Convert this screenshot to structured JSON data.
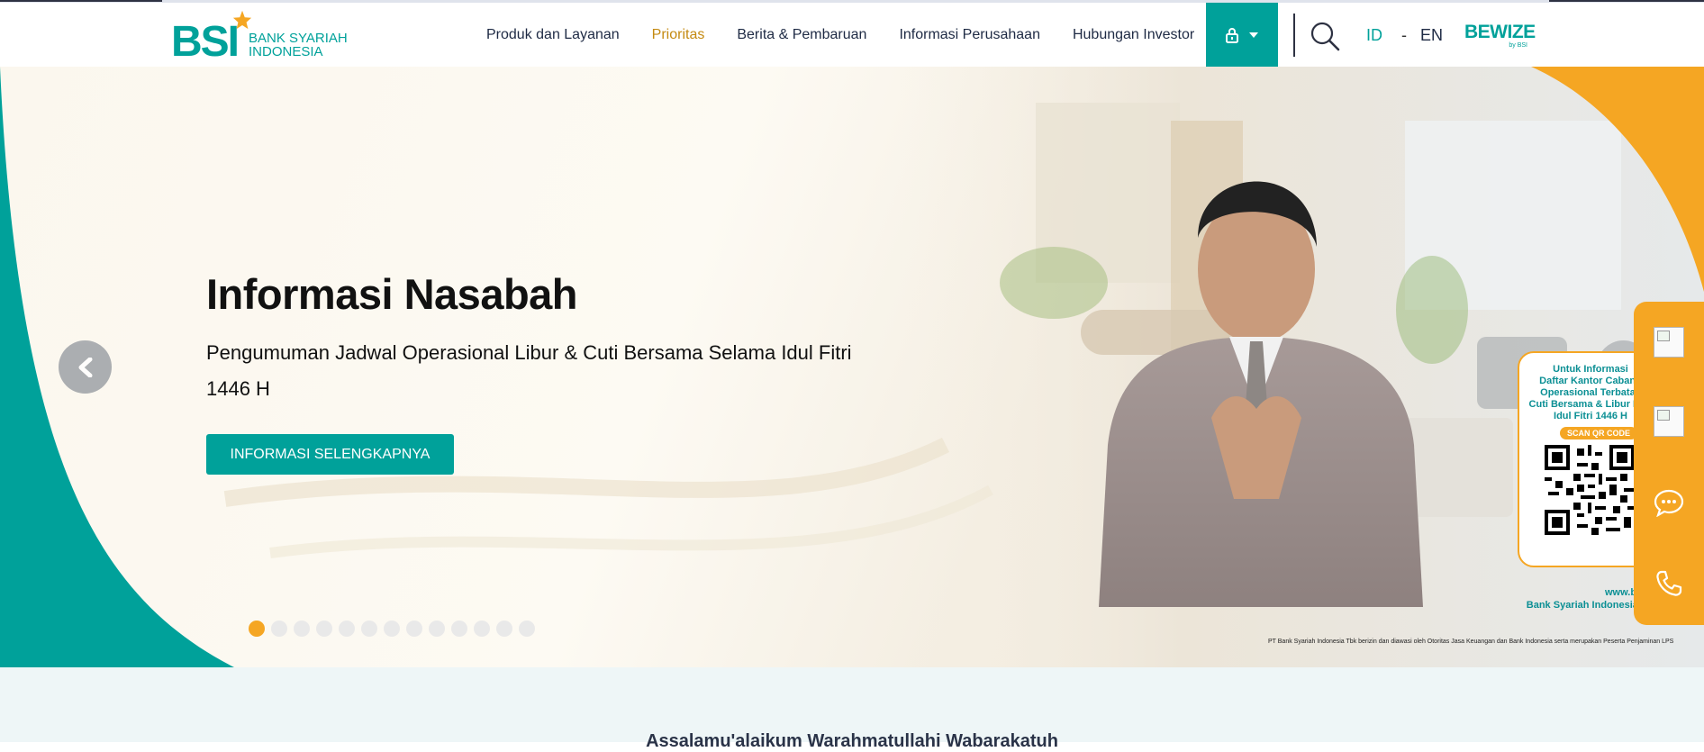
{
  "header": {
    "logo": {
      "mark": "BSI",
      "line1": "BANK SYARIAH",
      "line2": "INDONESIA"
    },
    "nav": [
      {
        "label": "Produk dan Layanan"
      },
      {
        "label": "Prioritas"
      },
      {
        "label": "Berita & Pembaruan"
      },
      {
        "label": "Informasi Perusahaan"
      },
      {
        "label": "Hubungan Investor"
      }
    ],
    "lang": {
      "id": "ID",
      "sep": "-",
      "en": "EN"
    },
    "bewize": {
      "name": "BEWIZE",
      "by": "by BSI"
    }
  },
  "hero": {
    "title": "Informasi Nasabah",
    "subtitle": "Pengumuman Jadwal Operasional Libur & Cuti Bersama Selama Idul Fitri 1446 H",
    "cta": "INFORMASI SELENGKAPNYA",
    "slides_total": 13,
    "active_slide": 1,
    "qr_card": {
      "info_lines": [
        "Untuk Informasi",
        "Daftar Kantor Cabang",
        "Operasional Terbatas",
        "Cuti Bersama & Libur Hari",
        "Idul Fitri 1446 H"
      ],
      "scan": "SCAN QR CODE"
    },
    "web_line1": "www.bank",
    "web_line2": "Bank Syariah Indonesia Ca",
    "footnote": "PT Bank Syariah Indonesia Tbk berizin dan diawasi oleh Otoritas Jasa Keuangan dan Bank Indonesia serta merupakan Peserta Penjaminan LPS"
  },
  "floating_bar": {
    "items": [
      "broken-image",
      "broken-image",
      "chat-icon",
      "phone-icon"
    ]
  },
  "below": {
    "greeting": "Assalamu'alaikum Warahmatullahi Wabarakatuh"
  },
  "colors": {
    "teal": "#00a19a",
    "orange": "#f5a623",
    "gold": "#c48a11",
    "navy": "#1e2a44"
  }
}
